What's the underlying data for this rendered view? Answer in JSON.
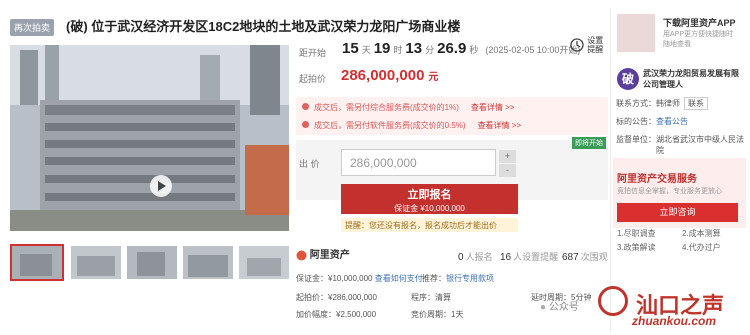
{
  "header": {
    "badge": "再次拍卖",
    "title": "(破) 位于武汉经济开发区18C2地块的土地及武汉荣力龙阳广场商业楼"
  },
  "countdown": {
    "label": "距开始",
    "days": "15",
    "days_unit": "天",
    "hours": "19",
    "hours_unit": "时",
    "minutes": "13",
    "minutes_unit": "分",
    "seconds": "26.9",
    "seconds_unit": "秒",
    "start_time": "(2025-02-05 10:00开始)",
    "remind_label": "设置提醒"
  },
  "price": {
    "label": "起拍价",
    "value": "286,000,000",
    "unit": "元"
  },
  "notices": [
    {
      "text": "成交后，需另付综合服务费(成交价的1%)",
      "link": "查看详情 >>"
    },
    {
      "text": "成交后，需另付软件服务费(成交价的0.5%)",
      "link": "查看详情 >>"
    }
  ],
  "bid": {
    "label": "出 价",
    "input_value": "286,000,000",
    "plus": "+",
    "minus": "-",
    "tag": "即将开始",
    "signup_label": "立即报名",
    "deposit_label": "保证金 ¥10,000,000",
    "tip": "提醒：您还没有报名，报名成功后才能出价"
  },
  "platform": {
    "name": "阿里资产",
    "stats": [
      {
        "value": "0",
        "label": "人报名"
      },
      {
        "value": "16",
        "label": "人设置提醒"
      },
      {
        "value": "687",
        "label": "次围观"
      }
    ]
  },
  "details": {
    "deposit": "保证金：¥10,000,000",
    "deposit_link": "查看如何支付",
    "recommend_label": "推荐：",
    "recommend_link": "银行专用款项",
    "start_price": "起拍价：¥286,000,000",
    "procedure": "程序：清算",
    "increment": "加价幅度：¥2,500,000",
    "bid_period": "竞价周期：1天",
    "extension": "延时周期：5分钟"
  },
  "sidebar": {
    "app_title": "下载阿里资产APP",
    "app_desc": "用APP更方便快捷随时随地查看",
    "org_icon": "破",
    "org_name": "武汉荣力龙阳贸易发展有限公司管理人",
    "contact_label": "联系方式：",
    "contact_name": "韩律师",
    "contact_btn": "联系",
    "notice_label": "标的公告：",
    "notice_link": "查看公告",
    "supervisor_label": "监督单位：",
    "supervisor_value": "湖北省武汉市中级人民法院",
    "service_title": "阿里资产交易服务",
    "service_desc": "竞拍信息全掌握，专业服务更放心",
    "service_btn": "立即咨询",
    "steps": [
      "1.尽职调查",
      "2.成本测算",
      "3.政策解读",
      "4.代办过户"
    ]
  },
  "watermark": {
    "wechat": "公众号",
    "brand": "汕口之声",
    "domain": "zhuankou.com"
  }
}
